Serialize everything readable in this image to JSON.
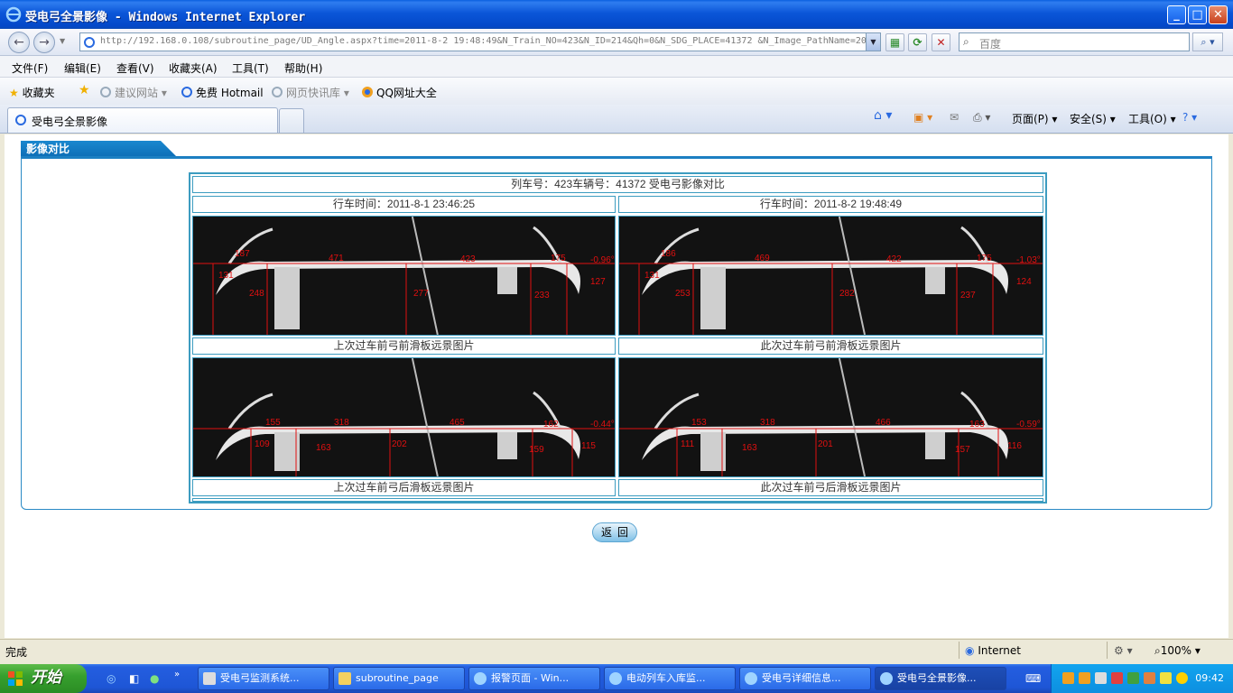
{
  "window": {
    "title": "受电弓全景影像 - Windows Internet Explorer",
    "min_glyph": "_",
    "max_glyph": "□",
    "close_glyph": "✕"
  },
  "address_bar": {
    "url": "http://192.168.0.108/subroutine_page/UD_Angle.aspx?time=2011-8-2 19:48:49&N_Train_NO=423&N_ID=214&Qh=0&N_SDG_PLACE=41372 &N_Image_PathName=20",
    "search_placeholder": "百度"
  },
  "menu": {
    "file": "文件(F)",
    "edit": "编辑(E)",
    "view": "查看(V)",
    "favorites": "收藏夹(A)",
    "tools": "工具(T)",
    "help": "帮助(H)"
  },
  "favorites_bar": {
    "favorites": "收藏夹",
    "suggested": "建议网站",
    "hotmail": "免费 Hotmail",
    "webslice": "网页快讯库",
    "qq": "QQ网址大全"
  },
  "tabs": {
    "active": "受电弓全景影像"
  },
  "command_bar": {
    "page": "页面(P)",
    "safety": "安全(S)",
    "tools": "工具(O)"
  },
  "page": {
    "section_title": "影像对比",
    "header": "列车号：423车辆号：41372   受电弓影像对比",
    "left_time": "行车时间：2011-8-1 23:46:25",
    "right_time": "行车时间：2011-8-2 19:48:49",
    "caption_prev_front": "上次过车前弓前滑板远景图片",
    "caption_curr_front": "此次过车前弓前滑板远景图片",
    "caption_prev_rear": "上次过车前弓后滑板远景图片",
    "caption_curr_rear": "此次过车前弓后滑板远景图片",
    "back_button": "返回"
  },
  "images": {
    "prev_front": [
      "187",
      "131",
      "248",
      "471",
      "277",
      "423",
      "233",
      "175",
      "-0.96°",
      "127"
    ],
    "curr_front": [
      "186",
      "131",
      "253",
      "469",
      "282",
      "422",
      "237",
      "175",
      "-1.03°",
      "124"
    ],
    "prev_rear": [
      "155",
      "109",
      "163",
      "318",
      "202",
      "465",
      "159",
      "162",
      "-0.44°",
      "115"
    ],
    "curr_rear": [
      "153",
      "111",
      "163",
      "318",
      "201",
      "466",
      "157",
      "163",
      "-0.59°",
      "116"
    ]
  },
  "status_bar": {
    "left": "完成",
    "zone": "Internet",
    "zoom": "100%"
  },
  "taskbar": {
    "start": "开始",
    "tasks": [
      "受电弓监测系统...",
      "subroutine_page",
      "报警页面 - Win...",
      "电动列车入库监...",
      "受电弓详细信息...",
      "受电弓全景影像..."
    ],
    "clock": "09:42"
  },
  "colors": {
    "accent": "#1c7fc2",
    "table_border": "#3c9cc0",
    "measure_red": "#e01010"
  }
}
